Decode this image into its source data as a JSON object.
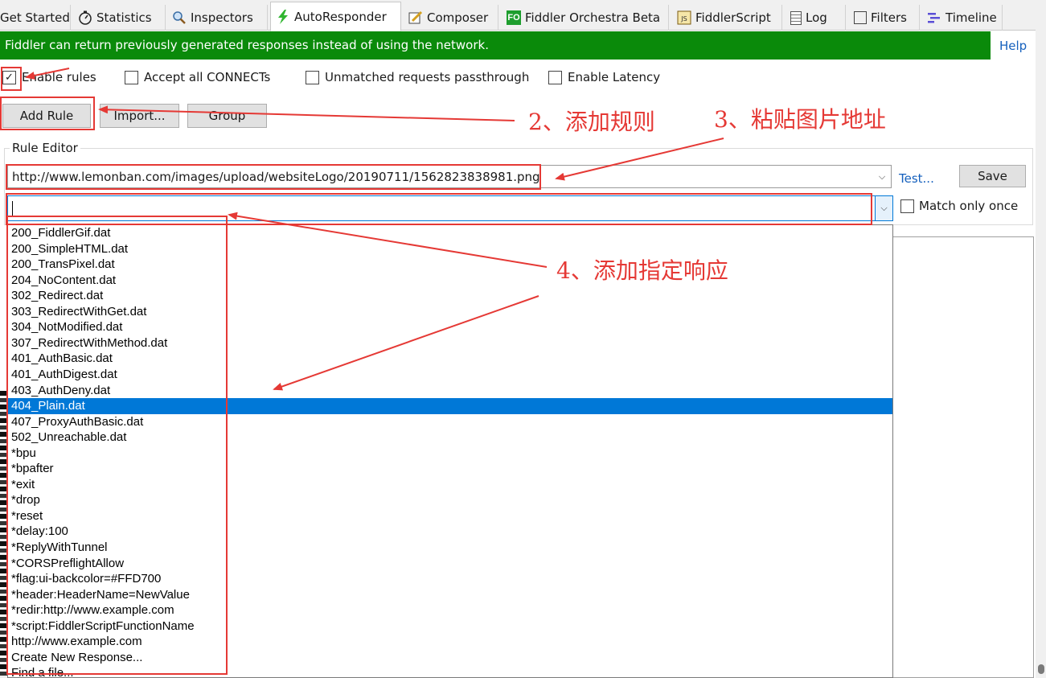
{
  "tabs": [
    {
      "label": "Get Started",
      "icon": "none"
    },
    {
      "label": "Statistics",
      "icon": "stopwatch-icon"
    },
    {
      "label": "Inspectors",
      "icon": "magnifier-icon"
    },
    {
      "label": "AutoResponder",
      "icon": "lightning-icon"
    },
    {
      "label": "Composer",
      "icon": "pencil-icon"
    },
    {
      "label": "Fiddler Orchestra Beta",
      "icon": "fo-icon",
      "icon_text": "FO"
    },
    {
      "label": "FiddlerScript",
      "icon": "script-icon",
      "icon_text": "JS"
    },
    {
      "label": "Log",
      "icon": "log-icon"
    },
    {
      "label": "Filters",
      "icon": "filter-checkbox-icon"
    },
    {
      "label": "Timeline",
      "icon": "timeline-icon"
    }
  ],
  "active_tab": "AutoResponder",
  "banner": {
    "text": "Fiddler can return previously generated responses instead of using the network.",
    "help": "Help",
    "color": "#0a8a0a"
  },
  "options": {
    "enable_rules": {
      "label": "Enable rules",
      "checked": true
    },
    "accept_connects": {
      "label": "Accept all CONNECTs",
      "checked": false
    },
    "unmatched_passthrough": {
      "label": "Unmatched requests passthrough",
      "checked": false
    },
    "enable_latency": {
      "label": "Enable Latency",
      "checked": false
    }
  },
  "buttons": {
    "add_rule": "Add Rule",
    "import": "Import...",
    "group": "Group"
  },
  "rule_editor": {
    "label": "Rule Editor",
    "match_value": "http://www.lemonban.com/images/upload/websiteLogo/20190711/1562823838981.png",
    "response_value": "",
    "test_link": "Test...",
    "save": "Save",
    "match_only_once": {
      "label": "Match only once",
      "checked": false
    }
  },
  "dropdown": {
    "selected": "404_Plain.dat",
    "items": [
      "200_FiddlerGif.dat",
      "200_SimpleHTML.dat",
      "200_TransPixel.dat",
      "204_NoContent.dat",
      "302_Redirect.dat",
      "303_RedirectWithGet.dat",
      "304_NotModified.dat",
      "307_RedirectWithMethod.dat",
      "401_AuthBasic.dat",
      "401_AuthDigest.dat",
      "403_AuthDeny.dat",
      "404_Plain.dat",
      "407_ProxyAuthBasic.dat",
      "502_Unreachable.dat",
      "*bpu",
      "*bpafter",
      "*exit",
      "*drop",
      "*reset",
      "*delay:100",
      "*ReplyWithTunnel",
      "*CORSPreflightAllow",
      "*flag:ui-backcolor=#FFD700",
      "*header:HeaderName=NewValue",
      "*redir:http://www.example.com",
      "*script:FiddlerScriptFunctionName",
      "http://www.example.com",
      "Create New Response...",
      "Find a file..."
    ]
  },
  "annotations": {
    "step2": "2、添加规则",
    "step3": "3、粘贴图片地址",
    "step4": "4、添加指定响应",
    "color": "#e53935"
  },
  "colors": {
    "selection": "#0078d7",
    "link": "#1560bd"
  }
}
